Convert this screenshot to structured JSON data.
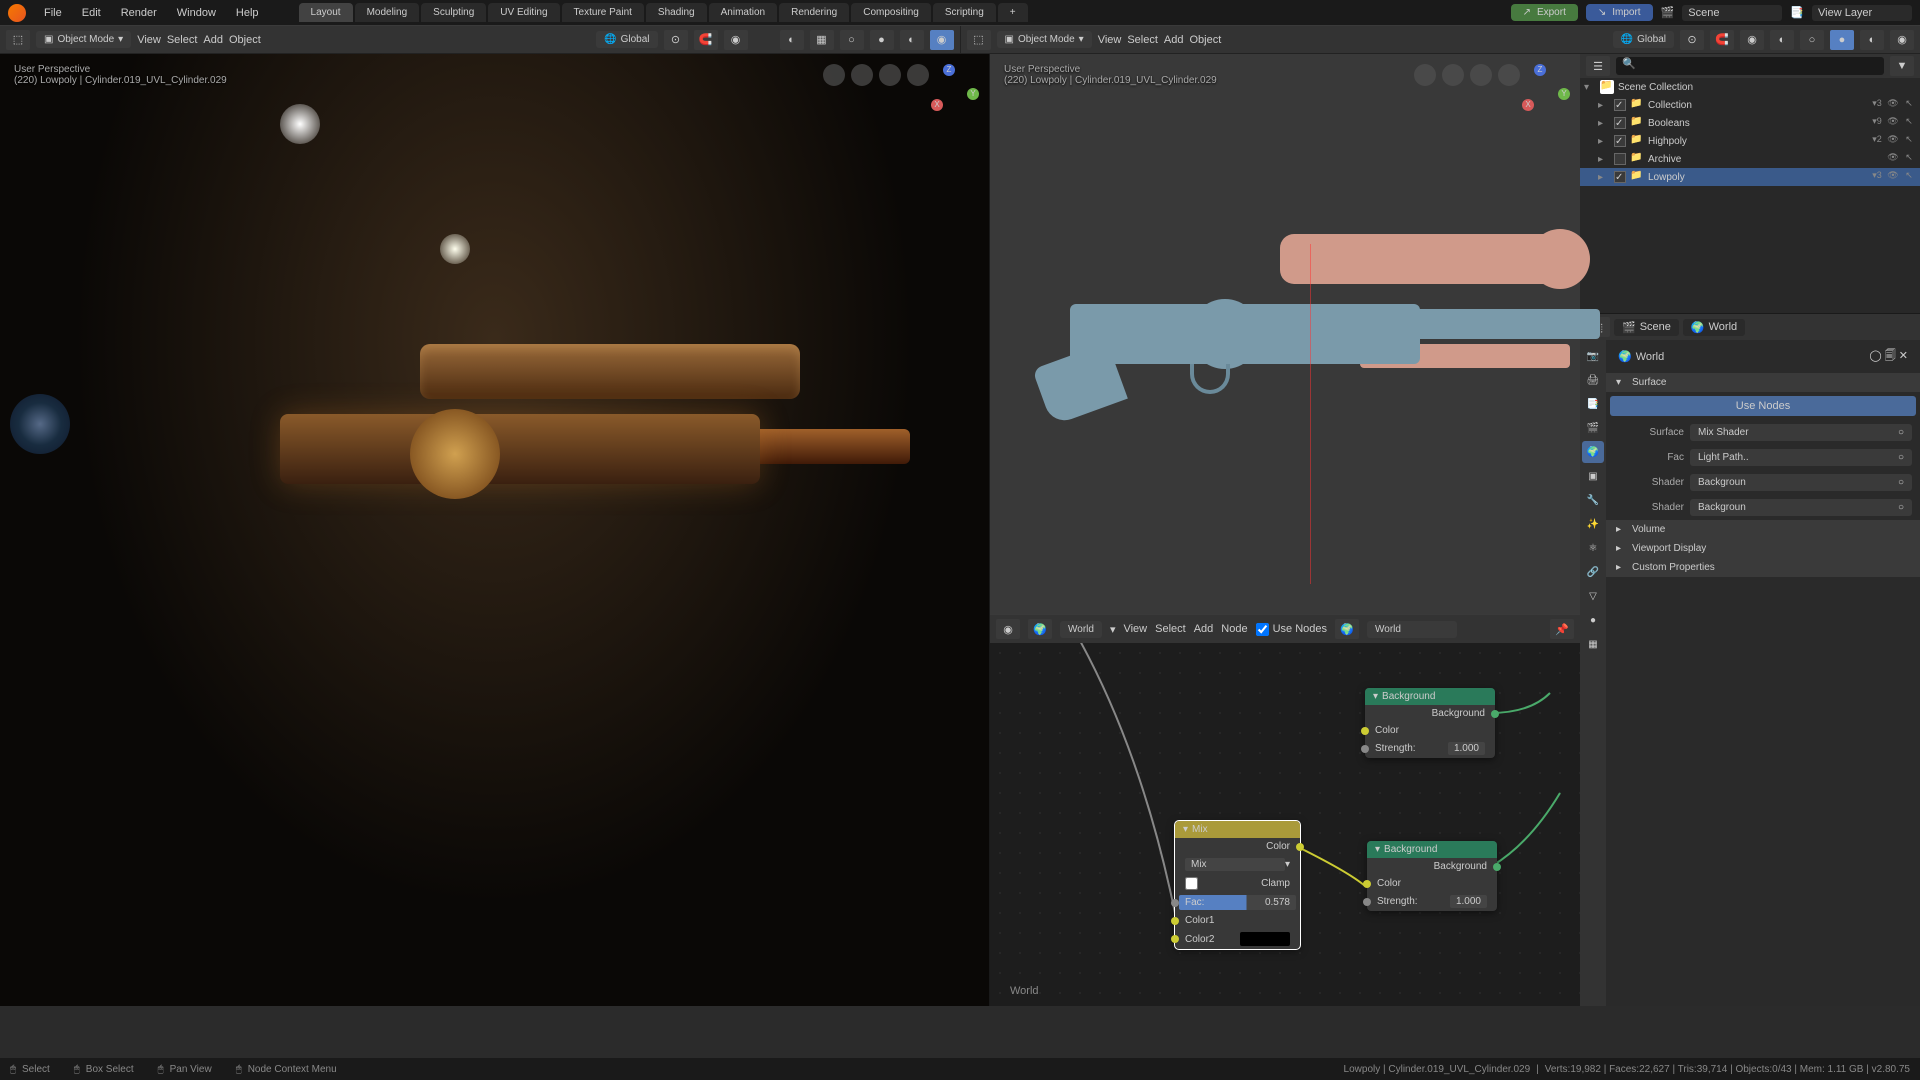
{
  "top_menu": {
    "items": [
      "File",
      "Edit",
      "Render",
      "Window",
      "Help"
    ],
    "tabs": [
      "Layout",
      "Modeling",
      "Sculpting",
      "UV Editing",
      "Texture Paint",
      "Shading",
      "Animation",
      "Rendering",
      "Compositing",
      "Scripting"
    ],
    "active_tab": "Layout",
    "export": "Export",
    "import": "Import",
    "scene_label": "Scene",
    "view_layer_label": "View Layer"
  },
  "toolbar_left": {
    "mode": "Object Mode",
    "menus": [
      "View",
      "Select",
      "Add",
      "Object"
    ],
    "orient": "Global"
  },
  "toolbar_right": {
    "mode": "Object Mode",
    "menus": [
      "View",
      "Select",
      "Add",
      "Object"
    ],
    "orient": "Global"
  },
  "viewport_left": {
    "label_line1": "User Perspective",
    "label_line2": "(220) Lowpoly | Cylinder.019_UVL_Cylinder.029"
  },
  "viewport_right": {
    "label_line1": "User Perspective",
    "label_line2": "(220) Lowpoly | Cylinder.019_UVL_Cylinder.029"
  },
  "node_editor": {
    "world_dropdown": "World",
    "menus": [
      "View",
      "Select",
      "Add",
      "Node"
    ],
    "use_nodes": "Use Nodes",
    "datablock": "World",
    "world_label": "World",
    "nodes": {
      "mix": {
        "title": "Mix",
        "color_out": "Color",
        "blend": "Mix",
        "clamp": "Clamp",
        "fac_label": "Fac:",
        "fac_value": "0.578",
        "color1": "Color1",
        "color2": "Color2"
      },
      "bg1": {
        "title": "Background",
        "output": "Background",
        "color": "Color",
        "strength_label": "Strength:",
        "strength_value": "1.000"
      },
      "bg2": {
        "title": "Background",
        "output": "Background",
        "color": "Color",
        "strength_label": "Strength:",
        "strength_value": "1.000"
      }
    }
  },
  "outliner": {
    "scene_collection": "Scene Collection",
    "items": [
      {
        "name": "Collection",
        "count": "3"
      },
      {
        "name": "Booleans",
        "count": "9"
      },
      {
        "name": "Highpoly",
        "count": "2"
      },
      {
        "name": "Archive",
        "count": ""
      },
      {
        "name": "Lowpoly",
        "count": "3",
        "selected": true
      }
    ]
  },
  "properties": {
    "scene_pill": "Scene",
    "world_pill": "World",
    "world_data": "World",
    "panels": {
      "surface": {
        "title": "Surface",
        "use_nodes": "Use Nodes",
        "rows": [
          {
            "label": "Surface",
            "value": "Mix Shader"
          },
          {
            "label": "Fac",
            "value": "Light Path.."
          },
          {
            "label": "Shader",
            "value": "Backgroun"
          },
          {
            "label": "Shader",
            "value": "Backgroun"
          }
        ]
      },
      "volume": "Volume",
      "viewport_display": "Viewport Display",
      "custom_props": "Custom Properties"
    }
  },
  "status_bar": {
    "select": "Select",
    "box_select": "Box Select",
    "pan_view": "Pan View",
    "context_menu": "Node Context Menu",
    "object_info": "Lowpoly | Cylinder.019_UVL_Cylinder.029",
    "stats": "Verts:19,982 | Faces:22,627 | Tris:39,714 | Objects:0/43 | Mem: 1.11 GB | v2.80.75"
  }
}
